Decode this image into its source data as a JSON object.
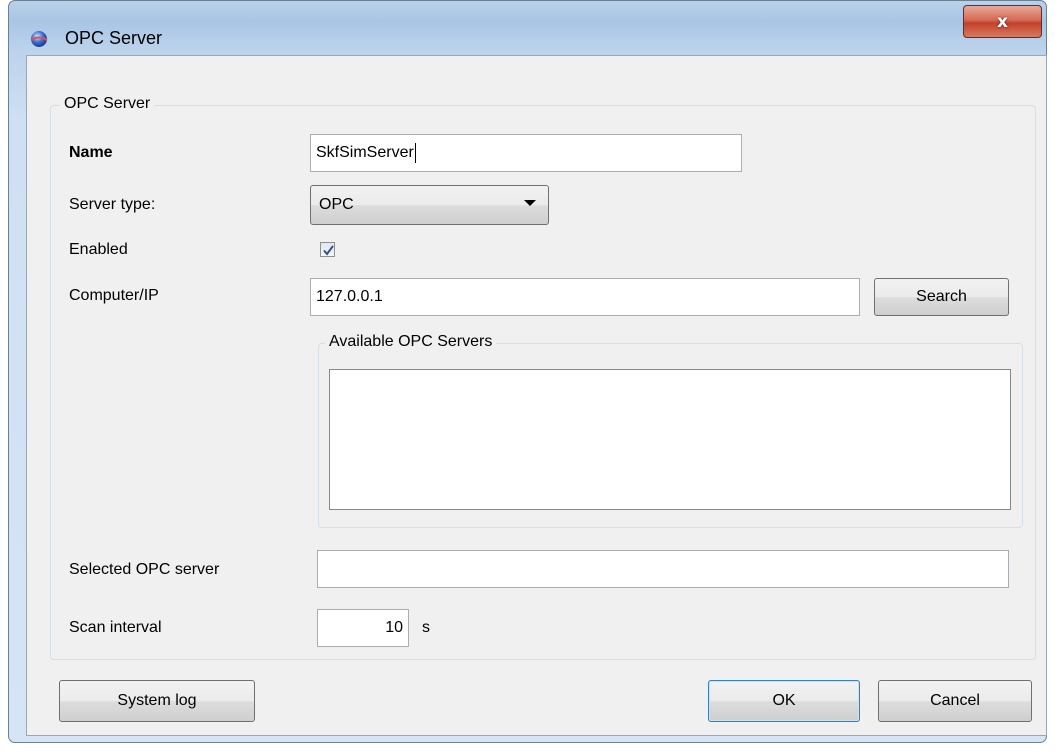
{
  "window": {
    "title": "OPC Server",
    "close_glyph": "x"
  },
  "group_main": {
    "legend": "OPC Server"
  },
  "fields": {
    "name_label": "Name",
    "name_value": "SkfSimServer",
    "server_type_label": "Server type:",
    "server_type_value": "OPC",
    "enabled_label": "Enabled",
    "enabled_checked": true,
    "computer_label": "Computer/IP",
    "computer_value": "127.0.0.1",
    "search_button": "Search",
    "selected_label": "Selected OPC server",
    "selected_value": "",
    "scan_label": "Scan interval",
    "scan_value": "10",
    "scan_unit": "s"
  },
  "group_available": {
    "legend": "Available OPC Servers",
    "items": []
  },
  "footer": {
    "system_log": "System log",
    "ok": "OK",
    "cancel": "Cancel"
  },
  "colors": {
    "frame": "#c9dcf1",
    "close_button": "#c84a34",
    "default_button_border": "#3c7fb1"
  },
  "icons": {
    "app_icon": "blue-globe-icon",
    "close_icon": "close-icon",
    "combo_arrow": "chevron-down-icon",
    "check_mark": "checkmark-icon"
  }
}
